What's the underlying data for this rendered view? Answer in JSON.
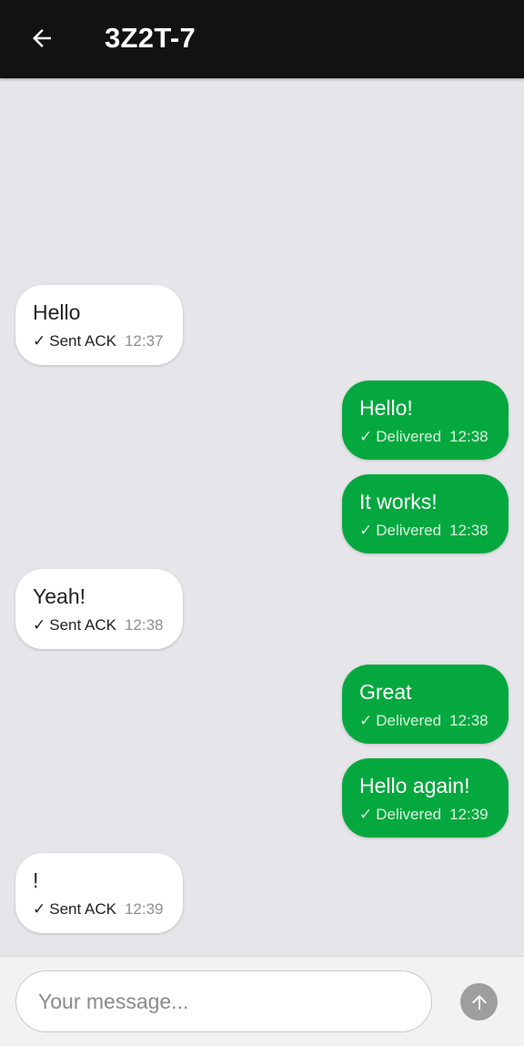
{
  "header": {
    "title": "3Z2T-7",
    "back_icon": "arrow-left-icon"
  },
  "messages": [
    {
      "direction": "incoming",
      "text": "Hello",
      "status": "Sent ACK",
      "time": "12:37"
    },
    {
      "direction": "outgoing",
      "text": "Hello!",
      "status": "Delivered",
      "time": "12:38"
    },
    {
      "direction": "outgoing",
      "text": "It works!",
      "status": "Delivered",
      "time": "12:38"
    },
    {
      "direction": "incoming",
      "text": "Yeah!",
      "status": "Sent ACK",
      "time": "12:38"
    },
    {
      "direction": "outgoing",
      "text": "Great",
      "status": "Delivered",
      "time": "12:38"
    },
    {
      "direction": "outgoing",
      "text": "Hello again!",
      "status": "Delivered",
      "time": "12:39"
    },
    {
      "direction": "incoming",
      "text": "!",
      "status": "Sent ACK",
      "time": "12:39"
    }
  ],
  "check_glyph": "✓",
  "composer": {
    "placeholder": "Your message...",
    "value": "",
    "send_icon": "arrow-up-icon"
  },
  "colors": {
    "appbar": "#121212",
    "outgoing_bubble": "#05a83f",
    "incoming_bubble": "#ffffff",
    "chat_background": "#e5e5ea",
    "send_button": "#9e9e9e"
  }
}
